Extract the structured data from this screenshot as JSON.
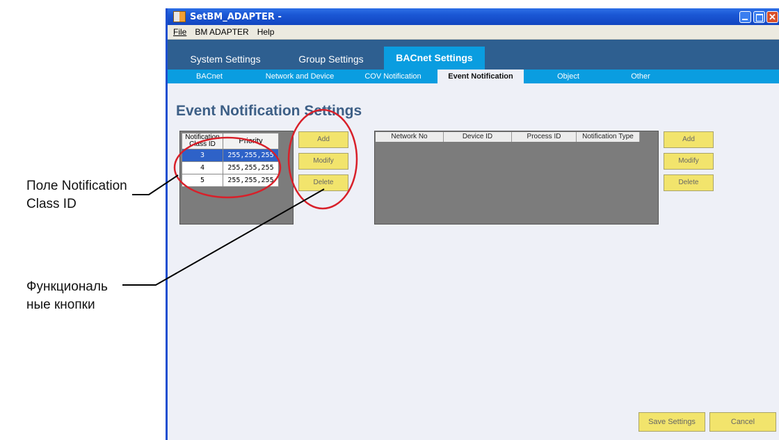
{
  "annotations": {
    "notification_field_line1": "Поле Notification",
    "notification_field_line2": "Class ID",
    "function_buttons_line1": "Функциональ",
    "function_buttons_line2": "ные кнопки"
  },
  "window": {
    "title": "SetBM_ADAPTER -"
  },
  "menu": {
    "file": "File",
    "bm_adapter": "BM ADAPTER",
    "help": "Help"
  },
  "tabs": [
    "System Settings",
    "Group Settings",
    "BACnet Settings"
  ],
  "subtabs": [
    "BACnet",
    "Network and Device",
    "COV Notification",
    "Event Notification",
    "Object",
    "Other"
  ],
  "page_title": "Event Notification Settings",
  "left_table": {
    "headers": [
      "Notification Class ID",
      "Priority"
    ],
    "rows": [
      {
        "id": "3",
        "priority": "255,255,255"
      },
      {
        "id": "4",
        "priority": "255,255,255"
      },
      {
        "id": "5",
        "priority": "255,255,255"
      }
    ]
  },
  "left_buttons": {
    "add": "Add",
    "modify": "Modify",
    "delete": "Delete"
  },
  "right_table": {
    "headers": [
      "Network No",
      "Device ID",
      "Process ID",
      "Notification Type"
    ]
  },
  "right_buttons": {
    "add": "Add",
    "modify": "Modify",
    "delete": "Delete"
  },
  "footer": {
    "save": "Save Settings",
    "cancel": "Cancel"
  },
  "colors": {
    "tab_bar": "#2e5f90",
    "accent_tab": "#0a9de0",
    "button_yellow": "#f2e46c",
    "annotation_red": "#d8202a"
  }
}
